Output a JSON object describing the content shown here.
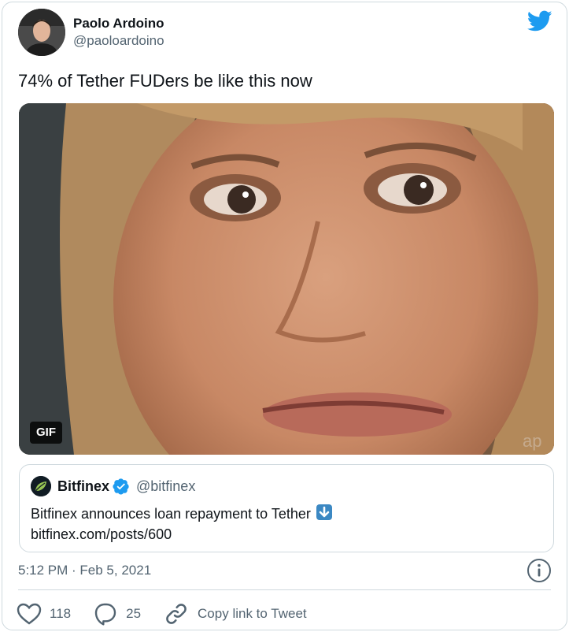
{
  "author": {
    "name": "Paolo Ardoino",
    "handle": "@paoloardoino"
  },
  "tweet": {
    "text": "74% of Tether FUDers be like this now",
    "media_badge": "GIF",
    "timestamp": "5:12 PM · Feb 5, 2021"
  },
  "quoted": {
    "name": "Bitfinex",
    "handle": "@bitfinex",
    "text": "Bitfinex announces loan repayment to Tether",
    "link": "bitfinex.com/posts/600"
  },
  "actions": {
    "like_count": "118",
    "reply_count": "25",
    "copy_link_label": "Copy link to Tweet"
  },
  "icons": {
    "brand": "twitter-bird-icon",
    "verified": "verified-badge-icon",
    "info": "info-icon",
    "like": "heart-icon",
    "reply": "speech-bubble-icon",
    "copy_link": "link-chain-icon"
  },
  "colors": {
    "brand": "#1d9bf0",
    "text_primary": "#0f1419",
    "text_secondary": "#536471",
    "border": "#cfd9de",
    "bitfinex_green": "#97c554"
  }
}
